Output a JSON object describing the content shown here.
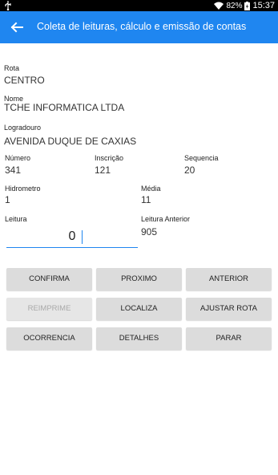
{
  "status_bar": {
    "battery": "82%",
    "time": "15:37"
  },
  "app_bar": {
    "title": "Coleta de leituras, cálculo e emissão de contas"
  },
  "fields": {
    "rota_label": "Rota",
    "rota_value": "CENTRO",
    "nome_label": "Nome",
    "nome_value": "TCHE INFORMATICA LTDA",
    "logradouro_label": "Logradouro",
    "logradouro_value": "AVENIDA DUQUE DE CAXIAS",
    "numero_label": "Número",
    "numero_value": "341",
    "inscricao_label": "Inscrição",
    "inscricao_value": "121",
    "sequencia_label": "Sequencia",
    "sequencia_value": "20",
    "hidrometro_label": "Hidrometro",
    "hidrometro_value": "1",
    "media_label": "Média",
    "media_value": "11",
    "leitura_label": "Leitura",
    "leitura_value": "0",
    "leitura_anterior_label": "Leitura Anterior",
    "leitura_anterior_value": "905"
  },
  "buttons": {
    "confirma": "CONFIRMA",
    "proximo": "PROXIMO",
    "anterior": "ANTERIOR",
    "reimprime": "REIMPRIME",
    "localiza": "LOCALIZA",
    "ajustar_rota": "AJUSTAR ROTA",
    "ocorrencia": "OCORRENCIA",
    "detalhes": "DETALHES",
    "parar": "PARAR"
  },
  "colors": {
    "accent": "#1f86f0",
    "button_bg": "#dcdcdc"
  }
}
